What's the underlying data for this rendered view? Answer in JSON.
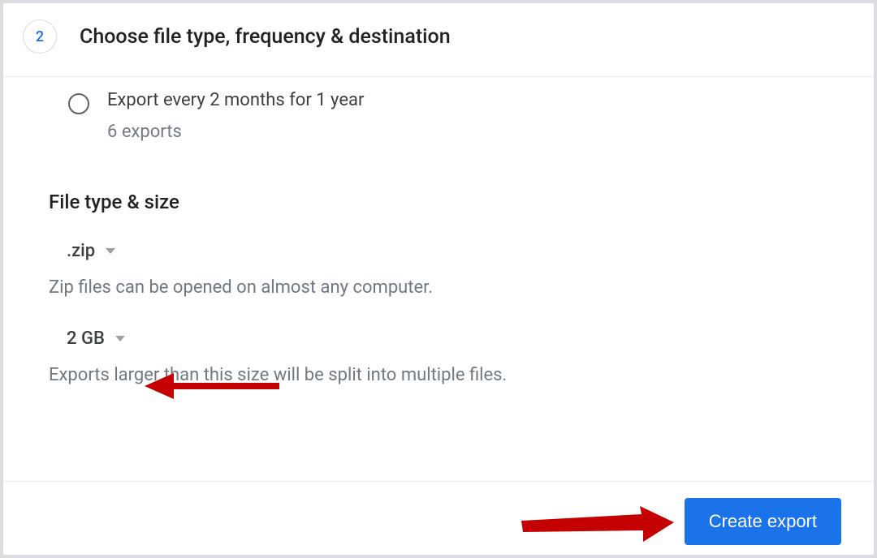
{
  "step": {
    "number": "2",
    "title": "Choose file type, frequency & destination"
  },
  "frequency_option": {
    "label": "Export every 2 months for 1 year",
    "sublabel": "6 exports"
  },
  "file_section": {
    "heading": "File type & size",
    "filetype": {
      "value": ".zip",
      "help": "Zip files can be opened on almost any computer."
    },
    "size": {
      "value": "2 GB",
      "help": "Exports larger than this size will be split into multiple files."
    }
  },
  "footer": {
    "create_label": "Create export"
  }
}
